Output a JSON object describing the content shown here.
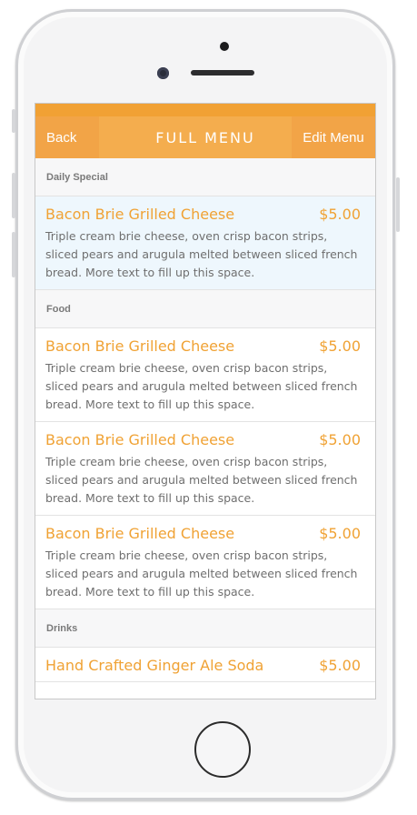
{
  "navbar": {
    "back_label": "Back",
    "title": "FULL MENU",
    "edit_label": "Edit Menu"
  },
  "colors": {
    "accent": "#f4ad4e",
    "accent_dark": "#f1a134",
    "item_text": "#f0a234",
    "highlight_bg": "#eef7fd"
  },
  "sections": [
    {
      "title": "Daily Special",
      "items": [
        {
          "name": "Bacon Brie Grilled Cheese",
          "price": "$5.00",
          "description": "Triple cream brie cheese, oven crisp bacon strips, sliced pears and arugula melted between sliced french bread. More text to fill up this space.",
          "highlighted": true
        }
      ]
    },
    {
      "title": "Food",
      "items": [
        {
          "name": "Bacon Brie Grilled Cheese",
          "price": "$5.00",
          "description": "Triple cream brie cheese, oven crisp bacon strips, sliced pears and arugula melted between sliced french bread. More text to fill up this space."
        },
        {
          "name": "Bacon Brie Grilled Cheese",
          "price": "$5.00",
          "description": "Triple cream brie cheese, oven crisp bacon strips, sliced pears and arugula melted between sliced french bread. More text to fill up this space."
        },
        {
          "name": "Bacon Brie Grilled Cheese",
          "price": "$5.00",
          "description": "Triple cream brie cheese, oven crisp bacon strips, sliced pears and arugula melted between sliced french bread. More text to fill up this space."
        }
      ]
    },
    {
      "title": "Drinks",
      "items": [
        {
          "name": "Hand Crafted Ginger Ale Soda",
          "price": "$5.00",
          "description": ""
        }
      ]
    }
  ]
}
